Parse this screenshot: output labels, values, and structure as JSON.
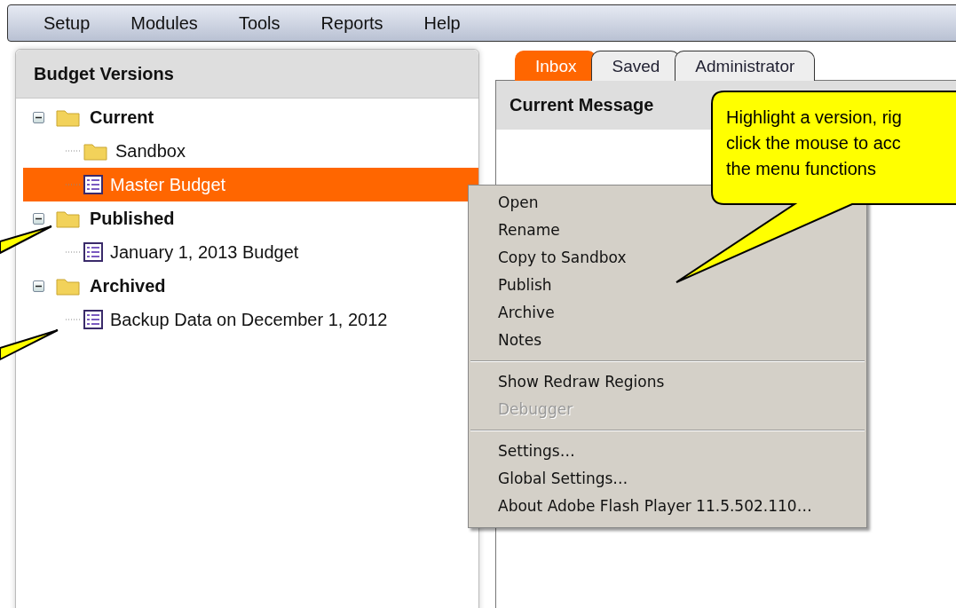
{
  "menu_bar": [
    "Setup",
    "Modules",
    "Tools",
    "Reports",
    "Help"
  ],
  "left_panel": {
    "title": "Budget Versions",
    "tree": [
      {
        "label": "Current",
        "kind": "folder",
        "expanded": true,
        "selected": false,
        "children": [
          {
            "label": "Sandbox",
            "kind": "folder",
            "selected": false
          },
          {
            "label": "Master Budget",
            "kind": "document",
            "selected": true
          }
        ]
      },
      {
        "label": "Published",
        "kind": "folder",
        "expanded": true,
        "selected": false,
        "children": [
          {
            "label": "January 1, 2013 Budget",
            "kind": "document",
            "selected": false
          }
        ]
      },
      {
        "label": "Archived",
        "kind": "folder",
        "expanded": true,
        "selected": false,
        "children": [
          {
            "label": "Backup Data on December 1, 2012",
            "kind": "document",
            "selected": false
          }
        ]
      }
    ]
  },
  "tabs": [
    {
      "label": "Inbox",
      "selected": true
    },
    {
      "label": "Saved",
      "selected": false
    },
    {
      "label": "Administrator",
      "selected": false
    }
  ],
  "right_panel": {
    "title": "Current Message"
  },
  "context_menu": {
    "sections": [
      [
        {
          "label": "Open",
          "disabled": false
        },
        {
          "label": "Rename",
          "disabled": false
        },
        {
          "label": "Copy to Sandbox",
          "disabled": false
        },
        {
          "label": "Publish",
          "disabled": false
        },
        {
          "label": "Archive",
          "disabled": false
        },
        {
          "label": "Notes",
          "disabled": false
        }
      ],
      [
        {
          "label": "Show Redraw Regions",
          "disabled": false
        },
        {
          "label": "Debugger",
          "disabled": true
        }
      ],
      [
        {
          "label": "Settings…",
          "disabled": false
        },
        {
          "label": "Global Settings…",
          "disabled": false
        },
        {
          "label": "About Adobe Flash Player 11.5.502.110…",
          "disabled": false
        }
      ]
    ]
  },
  "callout": {
    "lines": [
      "Highlight a version, rig",
      "click the mouse to acc",
      "the menu functions"
    ]
  }
}
